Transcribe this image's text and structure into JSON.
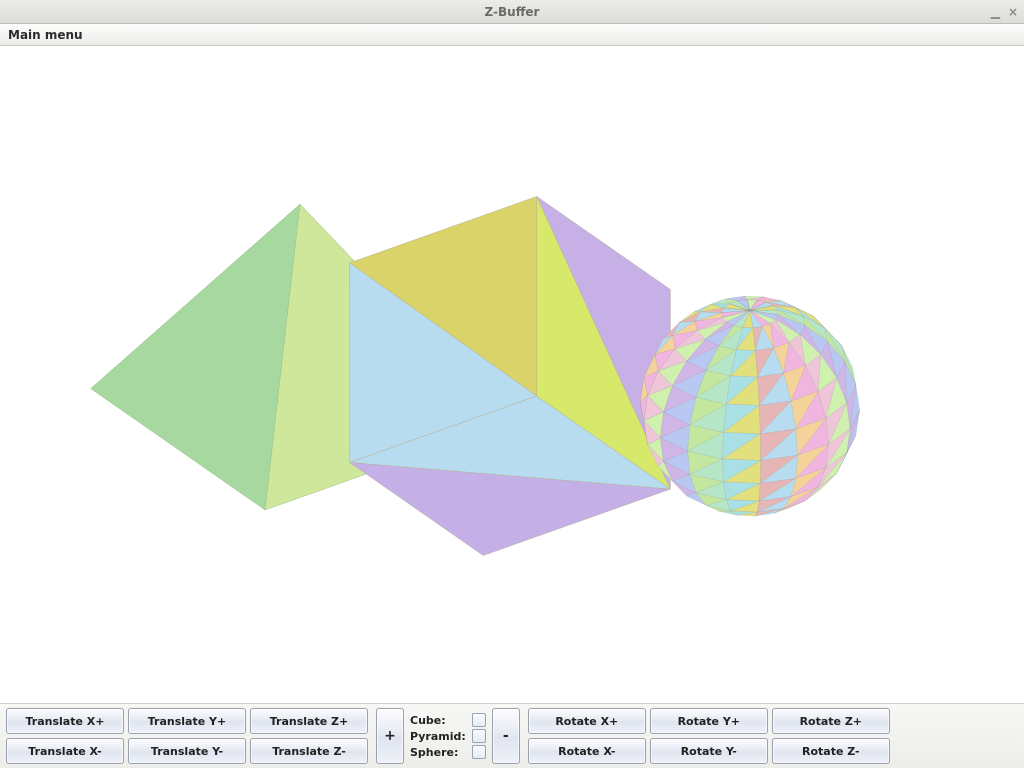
{
  "window": {
    "title": "Z-Buffer",
    "minimize_icon": "minimize-icon",
    "close_icon": "close-icon"
  },
  "menubar": {
    "main": "Main menu"
  },
  "bottom": {
    "translate": [
      "Translate X+",
      "Translate Y+",
      "Translate Z+",
      "Translate X-",
      "Translate Y-",
      "Translate Z-"
    ],
    "rotate": [
      "Rotate X+",
      "Rotate Y+",
      "Rotate Z+",
      "Rotate X-",
      "Rotate Y-",
      "Rotate Z-"
    ],
    "plus": "+",
    "minus": "-",
    "checks": {
      "cube": "Cube:",
      "pyramid": "Pyramid:",
      "sphere": "Sphere:"
    }
  }
}
